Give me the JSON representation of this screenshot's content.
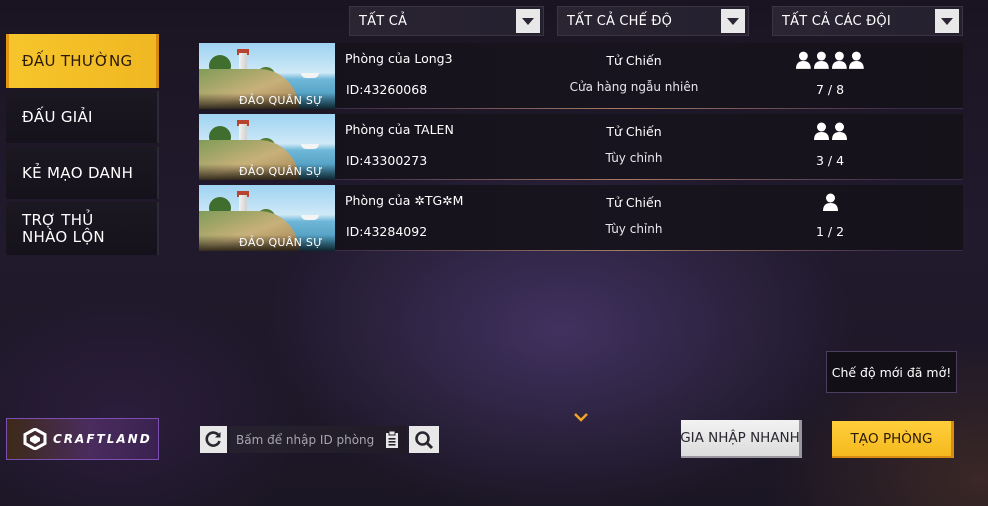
{
  "filters": {
    "all": "TẤT CẢ",
    "all_modes": "TẤT CẢ CHẾ ĐỘ",
    "all_teams": "TẤT CẢ CÁC ĐỘI"
  },
  "sidebar": {
    "items": [
      {
        "label": "ĐẤU THƯỜNG",
        "active": true
      },
      {
        "label": "ĐẤU GIẢI",
        "active": false
      },
      {
        "label": "KẺ MẠO DANH",
        "active": false
      },
      {
        "label": "TRỢ THỦ NHÀO LỘN",
        "active": false
      }
    ]
  },
  "rooms": [
    {
      "map": "ĐẢO QUÂN SỰ",
      "name": "Phòng của Long3",
      "id": "ID:43260068",
      "mode": "Tử Chiến",
      "sub": "Cửa hàng ngẫu nhiên",
      "players_icons": 4,
      "count": "7 / 8"
    },
    {
      "map": "ĐẢO QUÂN SỰ",
      "name": "Phòng của TALEN",
      "id": "ID:43300273",
      "mode": "Tử Chiến",
      "sub": "Tùy chỉnh",
      "players_icons": 2,
      "count": "3 / 4"
    },
    {
      "map": "ĐẢO QUÂN SỰ",
      "name": "Phòng của ✲TG✲M",
      "id": "ID:43284092",
      "mode": "Tử Chiến",
      "sub": "Tùy chỉnh",
      "players_icons": 1,
      "count": "1 / 2"
    }
  ],
  "craftland": {
    "label": "CRAFTLAND"
  },
  "search": {
    "placeholder": "Bấm để nhập ID phòng"
  },
  "tooltip": "Chế độ mới đã mở!",
  "buttons": {
    "quick_join": "GIA NHẬP NHANH",
    "create_room": "TẠO PHÒNG"
  },
  "icons": [
    "dropdown-arrow-icon",
    "person-icon",
    "refresh-icon",
    "paste-icon",
    "search-icon",
    "chevron-down-icon",
    "craftland-logo-icon"
  ],
  "colors": {
    "accent": "#f6c52c",
    "background": "#1d1727",
    "craftland_border": "#7b4fb0"
  }
}
